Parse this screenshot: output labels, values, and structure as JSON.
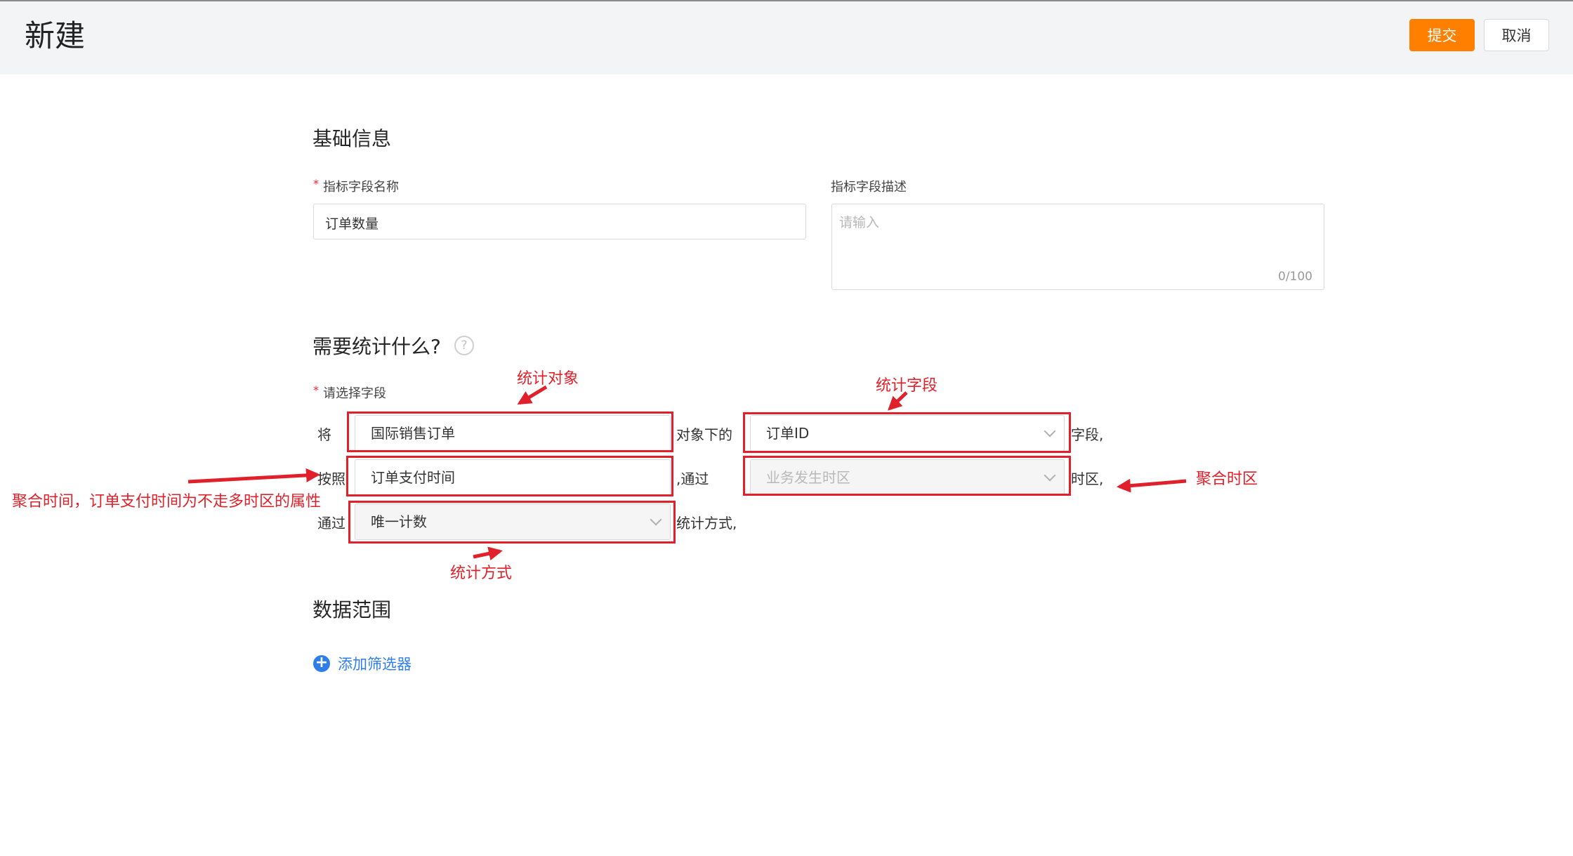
{
  "header": {
    "title": "新建",
    "submit_label": "提交",
    "cancel_label": "取消"
  },
  "basic_info": {
    "section_title": "基础信息",
    "name_field": {
      "required_mark": "*",
      "label": "指标字段名称",
      "value": "订单数量"
    },
    "desc_field": {
      "label": "指标字段描述",
      "placeholder": "请输入",
      "counter": "0/100"
    }
  },
  "stats": {
    "section_title": "需要统计什么?",
    "help_icon": "question-circle-icon",
    "required_mark": "*",
    "field_label": "请选择字段",
    "row1": {
      "prefix": "将",
      "object_value": "国际销售订单",
      "middle": "对象下的",
      "field_value": "订单ID",
      "suffix": "字段,"
    },
    "row2": {
      "prefix": "按照",
      "time_value": "订单支付时间",
      "middle": ",通过",
      "timezone_placeholder": "业务发生时区",
      "suffix": "时区,"
    },
    "row3": {
      "prefix": "通过",
      "method_value": "唯一计数",
      "suffix": "统计方式,"
    }
  },
  "data_range": {
    "section_title": "数据范围",
    "add_filter_label": "添加筛选器",
    "add_icon": "plus-circle-icon"
  },
  "annotations": {
    "stat_object": "统计对象",
    "stat_field": "统计字段",
    "agg_timezone": "聚合时区",
    "agg_time_note": "聚合时间，订单支付时间为不走多时区的属性",
    "stat_method": "统计方式",
    "color": "#e0202a"
  },
  "colors": {
    "accent": "#ff8000",
    "link": "#2f7ee8",
    "header_bg": "#f3f4f6"
  }
}
